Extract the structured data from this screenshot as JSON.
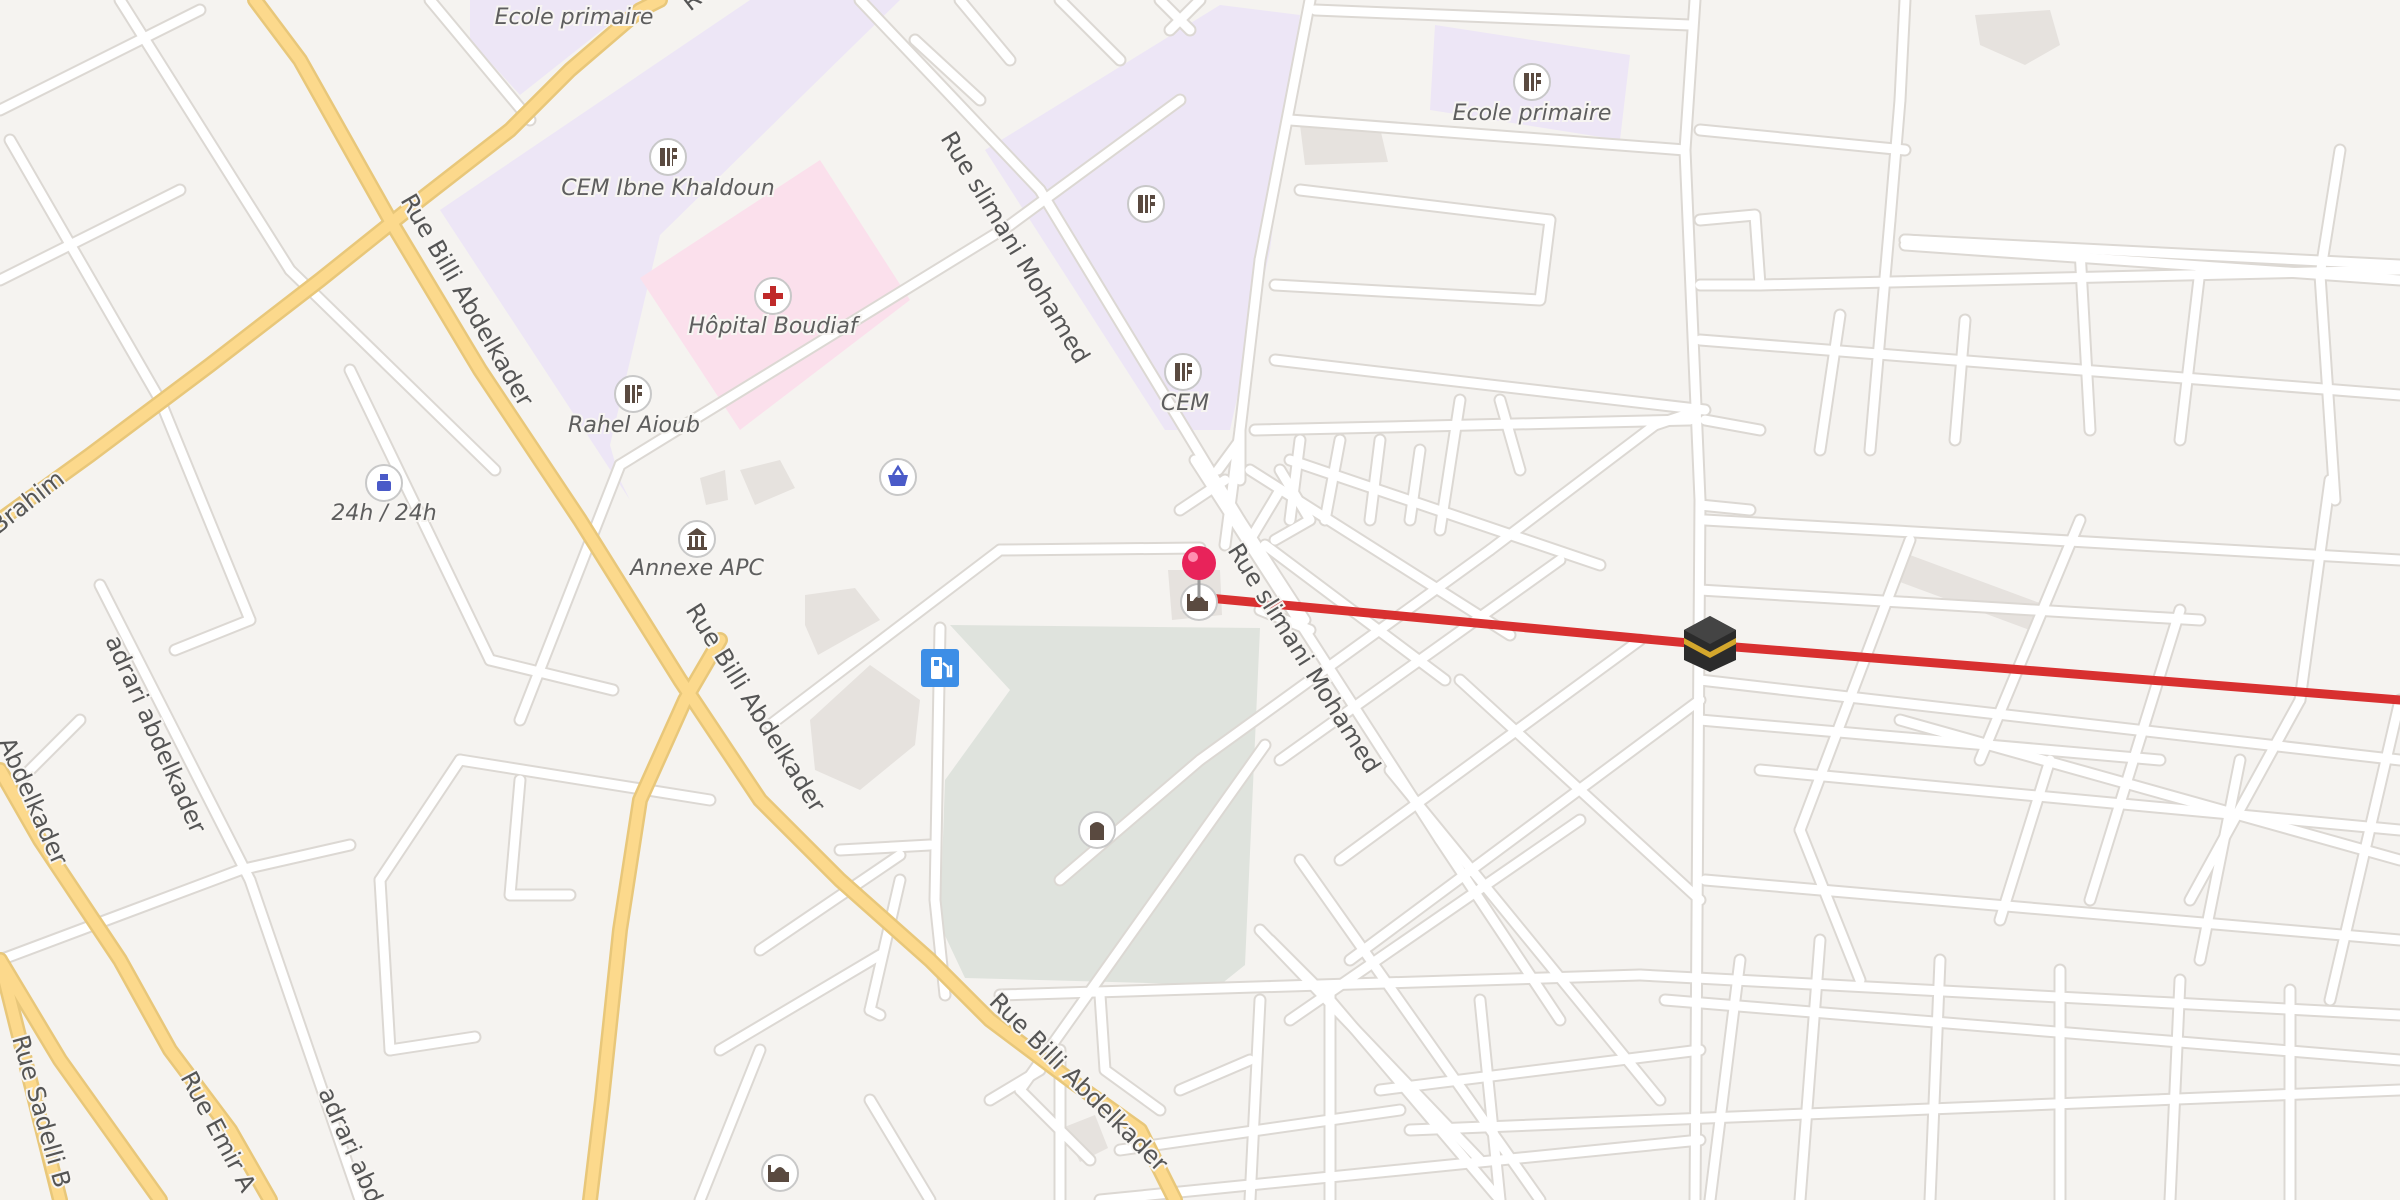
{
  "map": {
    "colors": {
      "background": "#f5f3f0",
      "school_area": "#ede6f6",
      "hospital_area": "#fbe0ec",
      "cemetery_area": "#dfe3dd",
      "building": "#e6e2de",
      "main_road": "#fcd98c",
      "route_line": "#d83030",
      "pin": "#e8235a"
    },
    "streets": {
      "billi_1": "Rue Billi Abdelkader",
      "billi_2": "Rue Billi Abdelkader",
      "billi_3": "Rue Billi Abdelkader",
      "slimani_1": "Rue slimani Mohamed",
      "slimani_2": "Rue slimani Mohamed",
      "brahim": "Brahim",
      "adrari_1": "adrari abdelkader",
      "adrari_2": "adrari abde",
      "abdelkader_left": "Abdelkader",
      "sadelli": "Rue Sadelli B",
      "emir": "Rue Emir A",
      "top_edge": "Ru"
    },
    "pois": {
      "ecole_top": {
        "label": "Ecole primaire",
        "icon": "school-icon"
      },
      "ecole_right": {
        "label": "Ecole primaire",
        "icon": "school-icon"
      },
      "cem_ibne": {
        "label": "CEM Ibne Khaldoun",
        "icon": "school-icon"
      },
      "school_unlabeled": {
        "icon": "school-icon"
      },
      "cem": {
        "label": "CEM",
        "icon": "school-icon"
      },
      "hopital": {
        "label": "Hôpital Boudiaf",
        "icon": "hospital-icon"
      },
      "rahel": {
        "label": "Rahel Aioub",
        "icon": "school-icon"
      },
      "pharmacy": {
        "label": "24h / 24h",
        "icon": "pharmacy-icon"
      },
      "annexe": {
        "label": "Annexe APC",
        "icon": "town-hall-icon"
      },
      "shop": {
        "icon": "shopping-basket-icon"
      },
      "fuel": {
        "icon": "fuel-station-icon"
      },
      "mosque_pin": {
        "icon": "mosque-icon"
      },
      "cemetery": {
        "icon": "cemetery-icon"
      },
      "mosque_bottom": {
        "icon": "mosque-icon"
      },
      "kaaba": {
        "icon": "kaaba-icon"
      }
    }
  }
}
